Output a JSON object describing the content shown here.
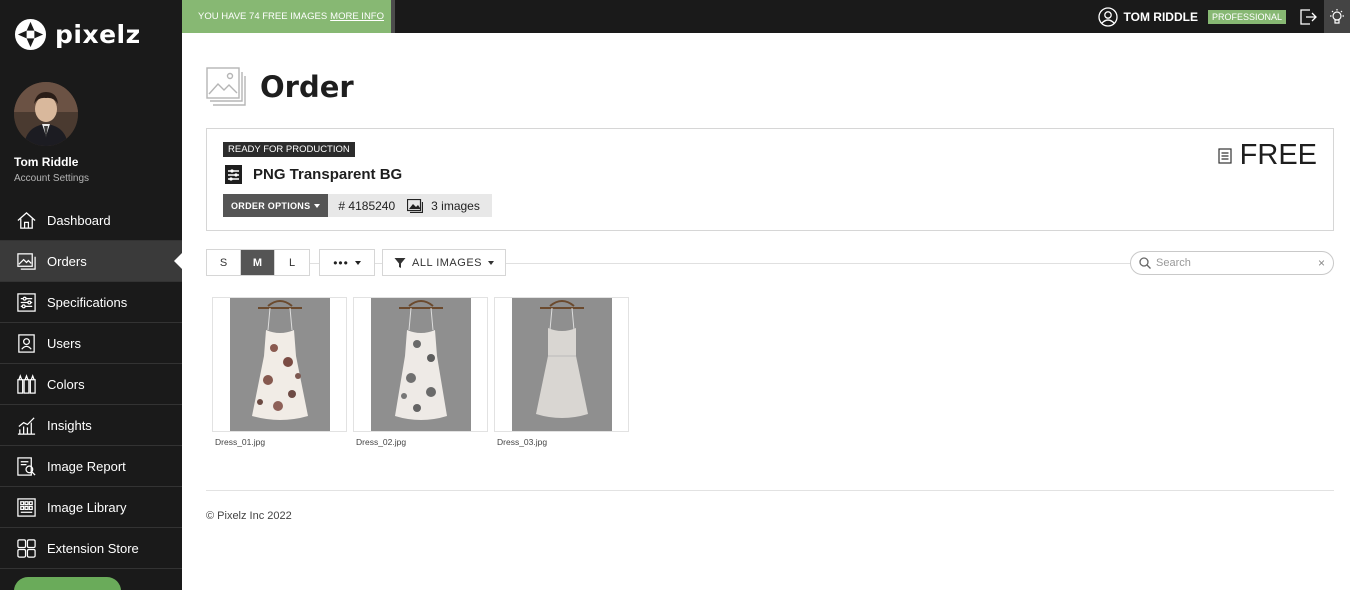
{
  "app": {
    "logo_text": "pixelz"
  },
  "user": {
    "name": "Tom Riddle",
    "account_link": "Account Settings"
  },
  "nav": {
    "items": [
      {
        "label": "Dashboard",
        "icon": "home-icon",
        "active": false
      },
      {
        "label": "Orders",
        "icon": "image-stack-icon",
        "active": true
      },
      {
        "label": "Specifications",
        "icon": "sliders-icon",
        "active": false
      },
      {
        "label": "Users",
        "icon": "user-card-icon",
        "active": false
      },
      {
        "label": "Colors",
        "icon": "paint-tubes-icon",
        "active": false
      },
      {
        "label": "Insights",
        "icon": "chart-icon",
        "active": false
      },
      {
        "label": "Image Report",
        "icon": "report-search-icon",
        "active": false
      },
      {
        "label": "Image Library",
        "icon": "grid-library-icon",
        "active": false
      },
      {
        "label": "Extension Store",
        "icon": "extensions-icon",
        "active": false
      }
    ]
  },
  "topbar": {
    "promo_text": "YOU HAVE 74 FREE IMAGES",
    "promo_link": "MORE INFO",
    "user_name": "TOM RIDDLE",
    "plan_badge": "PROFESSIONAL"
  },
  "page": {
    "title": "Order"
  },
  "order": {
    "status": "READY FOR PRODUCTION",
    "product": "PNG Transparent BG",
    "options_label": "ORDER OPTIONS",
    "order_id": "# 4185240",
    "image_count": "3 images",
    "price": "FREE"
  },
  "toolbar": {
    "sizes": [
      "S",
      "M",
      "L"
    ],
    "active_size": "M",
    "more_label": "•••",
    "filter_label": "ALL IMAGES",
    "search_placeholder": "Search",
    "clear_label": "×"
  },
  "images": [
    {
      "filename": "Dress_01.jpg"
    },
    {
      "filename": "Dress_02.jpg"
    },
    {
      "filename": "Dress_03.jpg"
    }
  ],
  "footer": {
    "copyright": "© Pixelz Inc 2022"
  },
  "colors": {
    "sidebar_bg": "#1a1a1a",
    "accent_green": "#87b873",
    "active_nav": "#3a3a3a"
  }
}
